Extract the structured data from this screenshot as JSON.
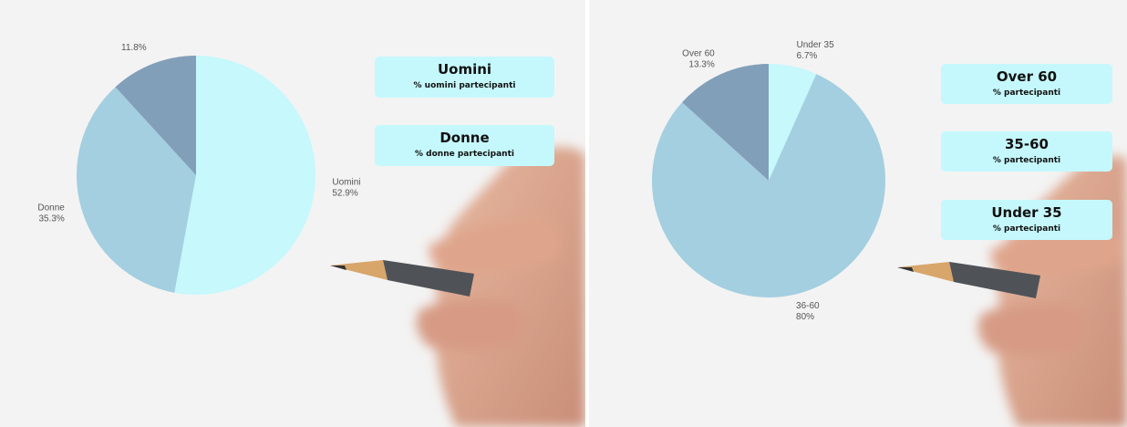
{
  "chart_data": [
    {
      "type": "pie",
      "slices": [
        {
          "name": "Uomini",
          "value": 52.9,
          "label": "52.9%",
          "color": "#c6f8fc"
        },
        {
          "name": "Donne",
          "value": 35.3,
          "label": "35.3%",
          "color": "#a3cfe0"
        },
        {
          "name": "",
          "value": 11.8,
          "label": "11.8%",
          "color": "#829fba"
        }
      ],
      "legend": [
        {
          "title": "Uomini",
          "subtitle": "% uomini partecipanti"
        },
        {
          "title": "Donne",
          "subtitle": "% donne partecipanti"
        }
      ]
    },
    {
      "type": "pie",
      "slices": [
        {
          "name": "Under 35",
          "value": 6.7,
          "label": "6.7%",
          "color": "#c6f8fc"
        },
        {
          "name": "36-60",
          "value": 80,
          "label": "80%",
          "color": "#a3cfe0"
        },
        {
          "name": "Over 60",
          "value": 13.3,
          "label": "13.3%",
          "color": "#829fba"
        }
      ],
      "legend": [
        {
          "title": "Over 60",
          "subtitle": "% partecipanti"
        },
        {
          "title": "35-60",
          "subtitle": "% partecipanti"
        },
        {
          "title": "Under 35",
          "subtitle": "% partecipanti"
        }
      ]
    }
  ]
}
